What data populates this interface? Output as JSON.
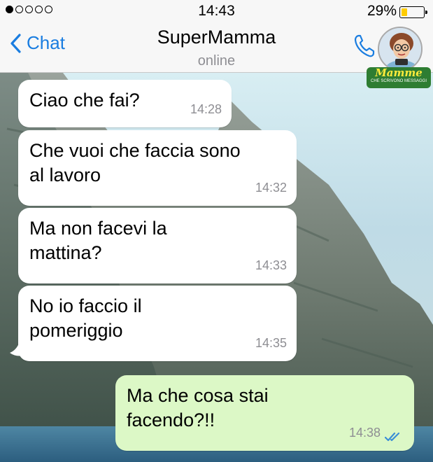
{
  "status_bar": {
    "signal_dots": [
      true,
      false,
      false,
      false,
      false
    ],
    "time": "14:43",
    "battery_percent": "29%",
    "battery_level": 0.29,
    "battery_color": "#ffcc00"
  },
  "nav": {
    "back_label": "Chat",
    "back_icon": "chevron-left-icon",
    "title": "SuperMamma",
    "subtitle": "online",
    "call_icon": "phone-icon",
    "accent_color": "#1a7de0"
  },
  "watermark": {
    "brand": "Mamme",
    "tagline": "CHE SCRIVONO MESSAGGI"
  },
  "messages": [
    {
      "direction": "in",
      "text": "Ciao che fai?",
      "time": "14:28"
    },
    {
      "direction": "in",
      "text": "Che vuoi che faccia sono\nal lavoro",
      "time": "14:32"
    },
    {
      "direction": "in",
      "text": "Ma non facevi la\nmattina?",
      "time": "14:33"
    },
    {
      "direction": "in",
      "text": "No io faccio il\npomeriggio",
      "time": "14:35"
    },
    {
      "direction": "out",
      "text": "Ma che cosa stai\nfacendo?!!",
      "time": "14:38",
      "read_receipt": "double-check-icon"
    }
  ],
  "colors": {
    "incoming_bubble": "#ffffff",
    "outgoing_bubble": "#dcf8c6",
    "read_tick": "#3b8fd6"
  }
}
